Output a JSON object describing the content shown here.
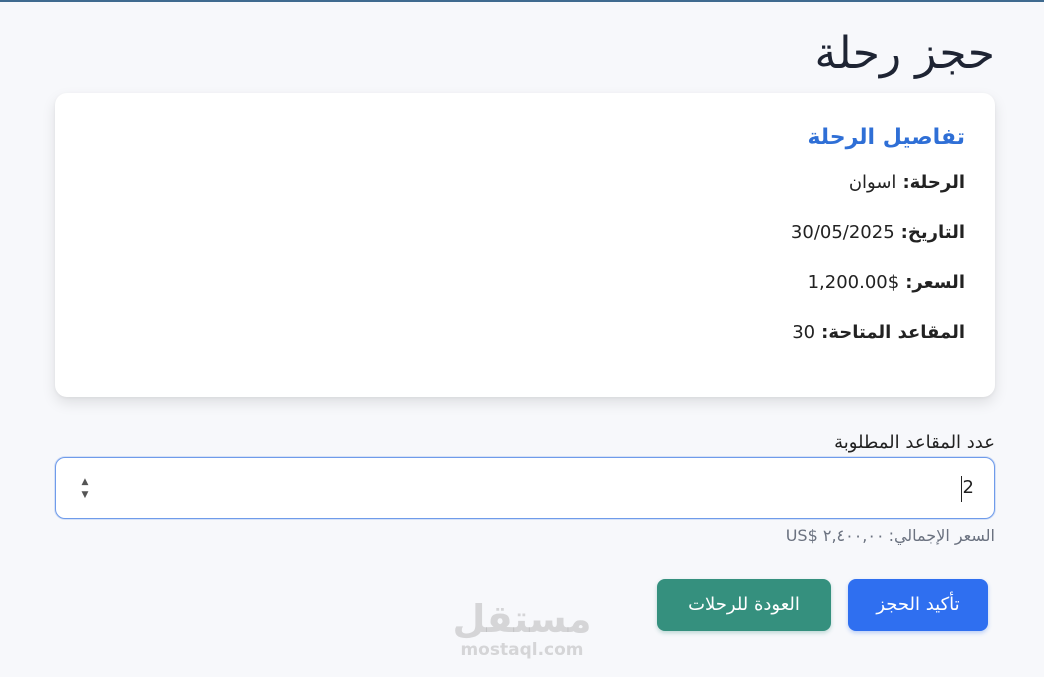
{
  "page": {
    "title": "حجز رحلة"
  },
  "details": {
    "heading": "تفاصيل الرحلة",
    "trip_label": "الرحلة:",
    "trip_value": "اسوان",
    "date_label": "التاريخ:",
    "date_value": "30/05/2025",
    "price_label": "السعر:",
    "price_value": "$1,200.00",
    "seats_label": "المقاعد المتاحة:",
    "seats_value": "30"
  },
  "booking": {
    "seats_field_label": "عدد المقاعد المطلوبة",
    "seats_field_value": "2",
    "total_label": "السعر الإجمالي:",
    "total_value": "US$ ٢,٤٠٠,٠٠"
  },
  "actions": {
    "confirm_label": "تأكيد الحجز",
    "back_label": "العودة للرحلات"
  },
  "watermark": {
    "arabic": "مستقل",
    "latin": "mostaql.com"
  },
  "colors": {
    "primary": "#2f6ff0",
    "secondary": "#35907e",
    "heading_accent": "#2f6fd6",
    "background": "#f7f8fb"
  },
  "icons": {
    "spinner_up": "chevron-up-icon",
    "spinner_down": "chevron-down-icon"
  }
}
